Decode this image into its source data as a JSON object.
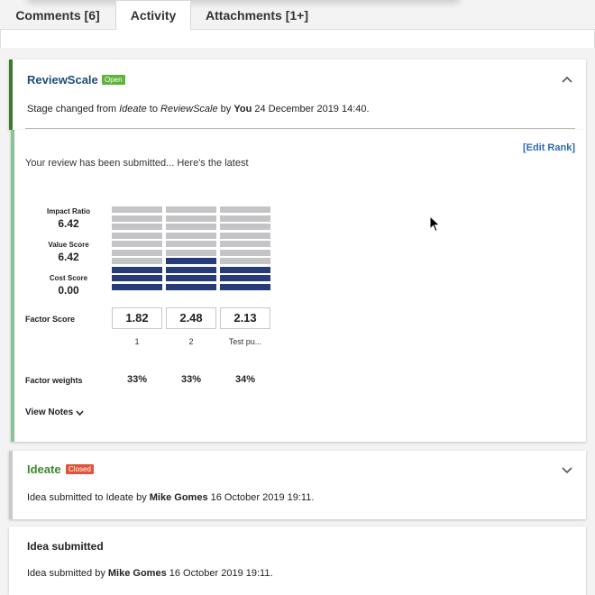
{
  "tabs": [
    {
      "label": "Comments [6]"
    },
    {
      "label": "Activity"
    },
    {
      "label": "Attachments [1+]"
    }
  ],
  "stages": {
    "current": {
      "name": "ReviewScale",
      "badge": "Open",
      "from_text": "Stage changed from ",
      "from": "Ideate",
      "to_text": " to ",
      "to": "ReviewScale",
      "by_text": " by ",
      "by": "You",
      "date": " 24 December 2019 14:40."
    },
    "ideate": {
      "name": "Ideate",
      "badge": "Closed",
      "text": "Idea submitted to Ideate by ",
      "by": "Mike Gomes",
      "date": " 16 October 2019 19:11."
    },
    "submitted": {
      "title": "Idea submitted",
      "text": "Idea submitted by ",
      "by": "Mike Gomes",
      "date": " 16 October 2019 19:11."
    }
  },
  "review": {
    "edit_rank": "[Edit Rank]",
    "message": "Your review has been submitted... Here's the latest",
    "impact_label": "Impact Ratio",
    "impact_value": "6.42",
    "value_label": "Value Score",
    "value_value": "6.42",
    "cost_label": "Cost Score",
    "cost_value": "0.00",
    "factor_score_label": "Factor Score",
    "factor_weights_label": "Factor weights",
    "view_notes": "View Notes",
    "factors": [
      {
        "name": "1",
        "score": "1.82",
        "weight": "33%",
        "filled": 3
      },
      {
        "name": "2",
        "score": "2.48",
        "weight": "33%",
        "filled": 4
      },
      {
        "name": "Test pu...",
        "score": "2.13",
        "weight": "34%",
        "filled": 3
      }
    ]
  },
  "colors": {
    "accent_green": "#3b8a2e",
    "open_badge": "#5cb53a",
    "closed_badge": "#e0553a",
    "bar_fill": "#263c7a",
    "link_blue": "#2e6bb8"
  }
}
